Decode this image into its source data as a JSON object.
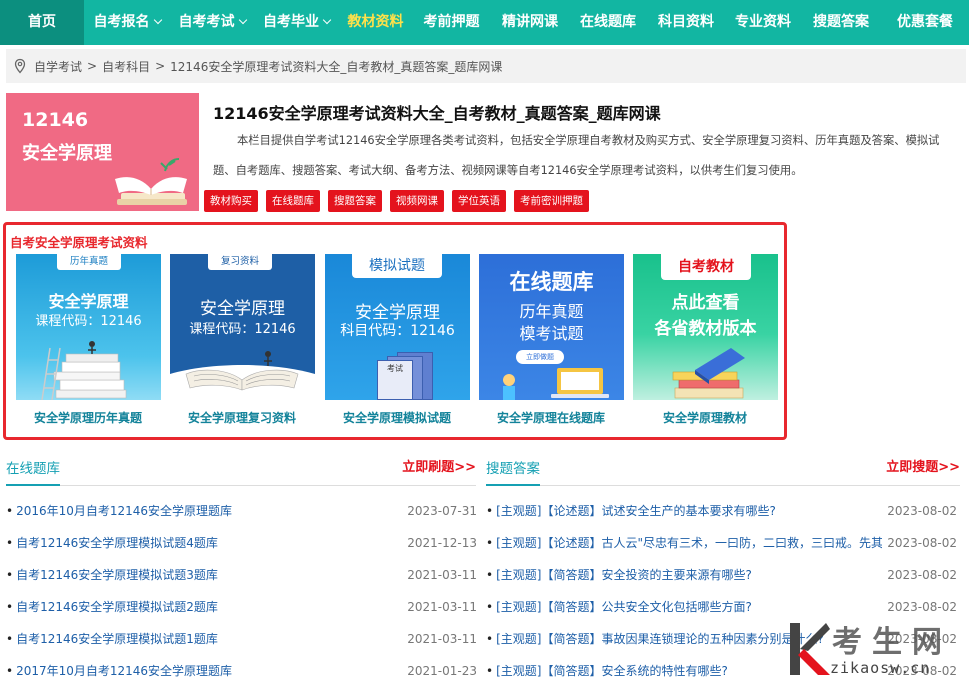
{
  "nav": {
    "items": [
      {
        "label": "首页"
      },
      {
        "label": "自考报名"
      },
      {
        "label": "自考考试"
      },
      {
        "label": "自考毕业"
      },
      {
        "label": "教材资料"
      },
      {
        "label": "考前押题"
      },
      {
        "label": "精讲网课"
      },
      {
        "label": "在线题库"
      },
      {
        "label": "科目资料"
      },
      {
        "label": "专业资料"
      },
      {
        "label": "搜题答案"
      },
      {
        "label": "优惠套餐"
      }
    ]
  },
  "breadcrumb": {
    "items": [
      "自学考试",
      "自考科目",
      "12146安全学原理考试资料大全_自考教材_真题答案_题库网课"
    ],
    "separator": ">"
  },
  "header": {
    "cover_code": "12146",
    "cover_name": "安全学原理",
    "title": "12146安全学原理考试资料大全_自考教材_真题答案_题库网课",
    "description": "本栏目提供自学考试12146安全学原理各类考试资料，包括安全学原理自考教材及购买方式、安全学原理复习资料、历年真题及答案、模拟试题、自考题库、搜题答案、考试大纲、备考方法、视频网课等自考12146安全学原理考试资料，以供考生们复习使用。",
    "tags": [
      "教材购买",
      "在线题库",
      "搜题答案",
      "视频网课",
      "学位英语",
      "考前密训押题"
    ]
  },
  "resources": {
    "title": "自考安全学原理考试资料",
    "cards": [
      {
        "badge": "历年真题",
        "line1": "安全学原理",
        "line2": "课程代码：12146",
        "caption": "安全学原理历年真题"
      },
      {
        "badge": "复习资料",
        "line1": "安全学原理",
        "line2": "课程代码：12146",
        "caption": "安全学原理复习资料"
      },
      {
        "badge": "模拟试题",
        "line1": "安全学原理",
        "line2": "科目代码：12146",
        "book_label": "考试",
        "caption": "安全学原理模拟试题"
      },
      {
        "badge": "在线题库",
        "line1": "历年真题",
        "line2": "模考试题",
        "button": "立即做题",
        "caption": "安全学原理在线题库"
      },
      {
        "badge": "自考教材",
        "line1": "点此查看",
        "line2": "各省教材版本",
        "caption": "安全学原理教材"
      }
    ]
  },
  "left_section": {
    "title": "在线题库",
    "more": "立即刷题>>",
    "items": [
      {
        "text": "2016年10月自考12146安全学原理题库",
        "date": "2023-07-31"
      },
      {
        "text": "自考12146安全学原理模拟试题4题库",
        "date": "2021-12-13"
      },
      {
        "text": "自考12146安全学原理模拟试题3题库",
        "date": "2021-03-11"
      },
      {
        "text": "自考12146安全学原理模拟试题2题库",
        "date": "2021-03-11"
      },
      {
        "text": "自考12146安全学原理模拟试题1题库",
        "date": "2021-03-11"
      },
      {
        "text": "2017年10月自考12146安全学原理题库",
        "date": "2021-01-23"
      }
    ]
  },
  "right_section": {
    "title": "搜题答案",
    "more": "立即搜题>>",
    "items": [
      {
        "text": "[主观题]【论述题】试述安全生产的基本要求有哪些?",
        "date": "2023-08-02"
      },
      {
        "text": "[主观题]【论述题】古人云\"尽忠有三术，一曰防，二曰救，三曰戒。先其",
        "date": "2023-08-02"
      },
      {
        "text": "[主观题]【简答题】安全投资的主要来源有哪些?",
        "date": "2023-08-02"
      },
      {
        "text": "[主观题]【简答题】公共安全文化包括哪些方面?",
        "date": "2023-08-02"
      },
      {
        "text": "[主观题]【简答题】事故因果连锁理论的五种因素分别是什么?",
        "date": "2023-08-02"
      },
      {
        "text": "[主观题]【简答题】安全系统的特性有哪些?",
        "date": "2023-08-02"
      }
    ]
  },
  "watermark": {
    "cn": "考生网",
    "en": "zikaosw.cn"
  },
  "colors": {
    "nav_bg": "#12b6a2",
    "nav_home_bg": "#0c8f7f",
    "nav_active": "#ffe14a",
    "accent_red": "#e4131d",
    "link_blue": "#1e5fa8",
    "section_teal": "#15a0b3"
  }
}
